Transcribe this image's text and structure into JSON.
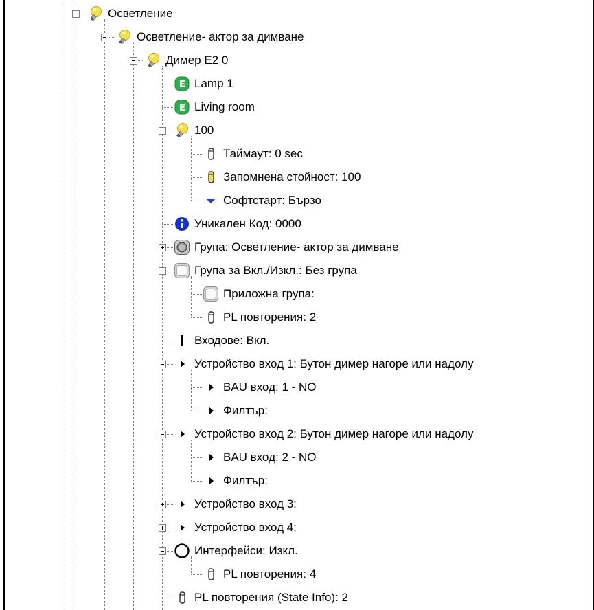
{
  "tree": {
    "nodes": [
      {
        "label": "Осветление",
        "icon": "bulb-icon"
      },
      {
        "label": "Осветление- актор за димване",
        "icon": "bulb-icon"
      },
      {
        "label": "Димер E2 0",
        "icon": "bulb-icon"
      },
      {
        "label": "Lamp 1",
        "icon": "green-e-icon"
      },
      {
        "label": "Living room",
        "icon": "green-e-icon"
      },
      {
        "label": "100",
        "icon": "bulb-icon"
      },
      {
        "label": "Таймаут: 0 sec",
        "icon": "cylinder-icon"
      },
      {
        "label": "Запомнена стойност: 100",
        "icon": "yellow-cylinder-icon"
      },
      {
        "label": "Софтстарт: Бързо",
        "icon": "blue-triangle-icon"
      },
      {
        "label": "Уникален Код: 0000",
        "icon": "info-icon"
      },
      {
        "label": "Група: Осветление- актор за димване",
        "icon": "group-button-icon"
      },
      {
        "label": "Група за Вкл./Изкл.: Без група",
        "icon": "white-button-icon"
      },
      {
        "label": "Приложна група:",
        "icon": "white-button-icon"
      },
      {
        "label": "PL повторения: 2",
        "icon": "cylinder-icon"
      },
      {
        "label": "Входове: Вкл.",
        "icon": "bar-icon"
      },
      {
        "label": "Устройство вход 1: Бутон димер нагоре или надолу",
        "icon": "arrow-right-icon"
      },
      {
        "label": "BAU вход: 1 - NO",
        "icon": "arrow-right-icon"
      },
      {
        "label": "Филтър:",
        "icon": "arrow-right-icon"
      },
      {
        "label": "Устройство вход 2: Бутон димер нагоре или надолу",
        "icon": "arrow-right-icon"
      },
      {
        "label": "BAU вход: 2 - NO",
        "icon": "arrow-right-icon"
      },
      {
        "label": "Филтър:",
        "icon": "arrow-right-icon"
      },
      {
        "label": "Устройство вход 3:",
        "icon": "arrow-right-icon"
      },
      {
        "label": "Устройство вход 4:",
        "icon": "arrow-right-icon"
      },
      {
        "label": "Интерфейси: Изкл.",
        "icon": "circle-icon"
      },
      {
        "label": "PL повторения: 4",
        "icon": "cylinder-icon"
      },
      {
        "label": "PL повторения (State Info): 2",
        "icon": "cylinder-icon"
      }
    ]
  },
  "colors": {
    "bulb": "#f3e04a",
    "green": "#2bb24a",
    "blue": "#1a3fe0",
    "info": "#1530d0",
    "line": "#808080"
  }
}
